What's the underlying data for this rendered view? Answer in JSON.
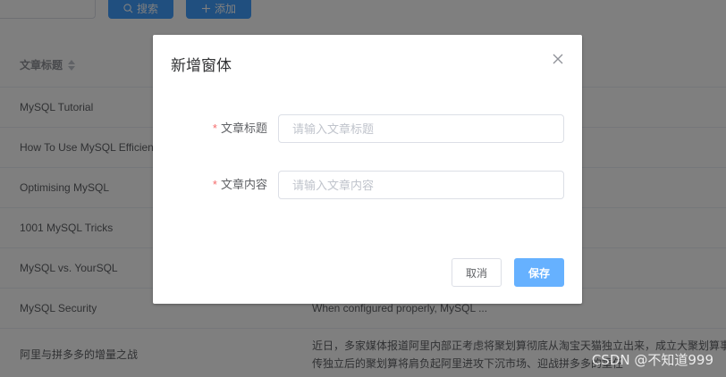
{
  "toolbar": {
    "search_label": "搜索",
    "add_label": "添加"
  },
  "table": {
    "header_title": "文章标题",
    "rows": [
      {
        "title": "MySQL Tutorial",
        "content": ""
      },
      {
        "title": "How To Use MySQL Efficien",
        "content": ""
      },
      {
        "title": "Optimising MySQL",
        "content": ""
      },
      {
        "title": "1001 MySQL Tricks",
        "content": ""
      },
      {
        "title": "MySQL vs. YourSQL",
        "content": ""
      },
      {
        "title": "MySQL Security",
        "content": "When configured properly, MySQL ..."
      },
      {
        "title": "阿里与拼多多的增量之战",
        "content_line1": "近日，多家媒体报道阿里内部正考虑将聚划算彻底从淘宝天猫独立出来，成立大聚划算事",
        "content_line2": "传独立后的聚划算将肩负起阿里进攻下沉市场、迎战拼多多的重任"
      }
    ]
  },
  "dialog": {
    "title": "新增窗体",
    "fields": [
      {
        "label": "文章标题",
        "required_mark": "*",
        "placeholder": "请输入文章标题",
        "value": ""
      },
      {
        "label": "文章内容",
        "required_mark": "*",
        "placeholder": "请输入文章内容",
        "value": ""
      }
    ],
    "cancel_label": "取消",
    "save_label": "保存"
  },
  "watermark": "CSDN @不知道999",
  "colors": {
    "primary": "#409eff",
    "save_button": "#66b1ff",
    "required": "#f56c6c"
  }
}
